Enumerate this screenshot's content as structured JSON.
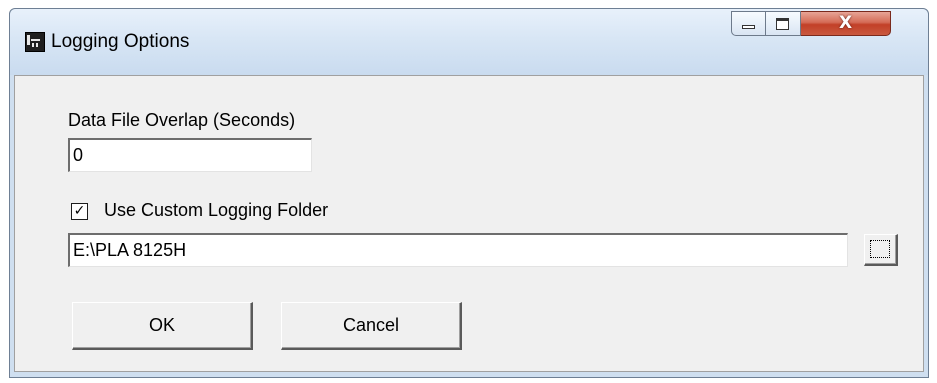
{
  "window": {
    "title": "Logging Options",
    "controls": {
      "close_glyph": "X"
    }
  },
  "overlap": {
    "label": "Data File Overlap (Seconds)",
    "value": "0"
  },
  "custom_folder": {
    "checkbox_label": "Use Custom Logging Folder",
    "checked": true,
    "check_glyph": "✓",
    "path_value": "E:\\PLA 8125H"
  },
  "buttons": {
    "ok": "OK",
    "cancel": "Cancel"
  },
  "icons": {
    "app": "app-icon",
    "minimize": "minimize-icon",
    "maximize": "maximize-icon",
    "close": "close-icon",
    "browse": "browse-folder-icon"
  },
  "colors": {
    "close_button": "#c24028",
    "client_background": "#f0f0f0",
    "frame": "#cfdff0"
  }
}
